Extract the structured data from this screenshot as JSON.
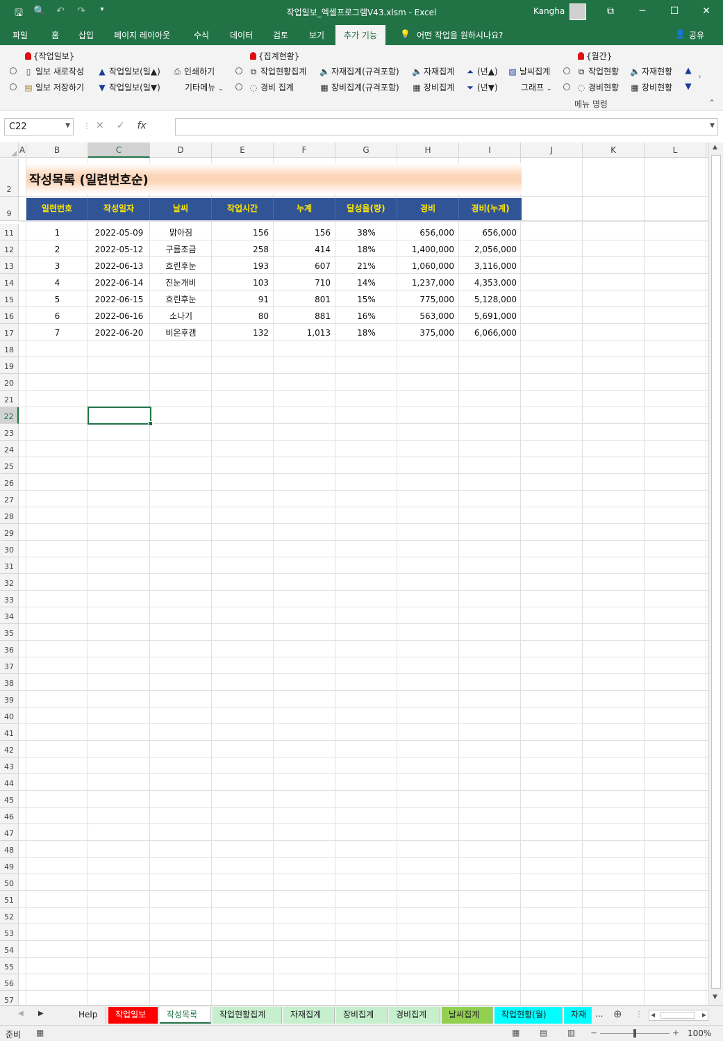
{
  "app": {
    "title": "작업일보_엑셀프로그램V43.xlsm  -  Excel",
    "user": "Kangha",
    "window_controls": [
      "restore-icon",
      "minimize-icon",
      "maximize-icon",
      "close-icon"
    ]
  },
  "qat": [
    "save-icon",
    "print-preview-icon",
    "undo-icon",
    "redo-icon",
    "customize-icon"
  ],
  "menu": {
    "items": [
      "파일",
      "홈",
      "삽입",
      "페이지 레이아웃",
      "수식",
      "데이터",
      "검토",
      "보기",
      "추가 기능"
    ],
    "active": "추가 기능",
    "tell_me": "어떤 작업을 원하시나요?",
    "share": "공유"
  },
  "ribbon": {
    "group1_header": "{작업일보}",
    "g1_new": "일보 새로작성",
    "g1_save": "일보 저장하기",
    "g1_up": "작업일보(일▲)",
    "g1_down": "작업일보(일▼)",
    "g1_print": "인쇄하기",
    "g1_other": "기타메뉴",
    "group2_header": "{집계현황}",
    "g2_work": "작업현황집계",
    "g2_cost": "경비 집계",
    "g2_mat_spec": "자재집계(규격포함)",
    "g2_eq_spec": "장비집계(규격포함)",
    "g2_mat": "자재집계",
    "g2_eq": "장비집계",
    "g2_year_up": "(년▲)",
    "g2_year_down": "(년▼)",
    "g2_weather": "날씨집계",
    "g2_graph": "그래프",
    "group3_header": "{월간}",
    "g3_work": "작업현황",
    "g3_cost": "경비현황",
    "g3_mat": "자재현황",
    "g3_eq": "장비현황",
    "footer": "메뉴 명령"
  },
  "formula": {
    "namebox": "C22",
    "value": ""
  },
  "sheet": {
    "columns": [
      "A",
      "B",
      "C",
      "D",
      "E",
      "F",
      "G",
      "H",
      "I",
      "J",
      "K",
      "L"
    ],
    "rows": [
      "2",
      "9",
      "11",
      "12",
      "13",
      "14",
      "15",
      "16",
      "17",
      "18",
      "19",
      "20",
      "21",
      "22",
      "23",
      "24",
      "25",
      "26",
      "27",
      "28",
      "29",
      "30",
      "31",
      "32",
      "33",
      "34",
      "35",
      "36",
      "37",
      "38",
      "39",
      "40",
      "41",
      "42",
      "43",
      "44",
      "45",
      "46",
      "47",
      "48",
      "49",
      "50",
      "51",
      "52",
      "53",
      "54",
      "55",
      "56",
      "57"
    ],
    "title": "작성목록 (일련번호순)",
    "headers": [
      "일련번호",
      "작성일자",
      "날씨",
      "작업시간",
      "누계",
      "달성율(량)",
      "경비",
      "경비(누계)"
    ],
    "data": [
      [
        "1",
        "2022-05-09",
        "맑아짐",
        "156",
        "156",
        "38%",
        "656,000",
        "656,000"
      ],
      [
        "2",
        "2022-05-12",
        "구름조금",
        "258",
        "414",
        "18%",
        "1,400,000",
        "2,056,000"
      ],
      [
        "3",
        "2022-06-13",
        "흐린후눈",
        "193",
        "607",
        "21%",
        "1,060,000",
        "3,116,000"
      ],
      [
        "4",
        "2022-06-14",
        "진눈개비",
        "103",
        "710",
        "14%",
        "1,237,000",
        "4,353,000"
      ],
      [
        "5",
        "2022-06-15",
        "흐린후눈",
        "91",
        "801",
        "15%",
        "775,000",
        "5,128,000"
      ],
      [
        "6",
        "2022-06-16",
        "소나기",
        "80",
        "881",
        "16%",
        "563,000",
        "5,691,000"
      ],
      [
        "7",
        "2022-06-20",
        "비온후갬",
        "132",
        "1,013",
        "18%",
        "375,000",
        "6,066,000"
      ]
    ]
  },
  "tabs": [
    "Help",
    "작업일보",
    "작성목록",
    "작업현황집계",
    "자재집계",
    "장비집계",
    "경비집계",
    "날씨집계",
    "작업현황(월)",
    "자재"
  ],
  "tab_colors": {
    "작업일보": "#ff0000",
    "작성목록": "#ffffff",
    "작업현황집계": "#c6efce",
    "자재집계": "#c6efce",
    "장비집계": "#c6efce",
    "경비집계": "#c6efce",
    "날씨집계": "#92d050",
    "작업현황(월)": "#00ffff",
    "자재": "#00ffff"
  },
  "status": {
    "ready": "준비",
    "zoom": "100%"
  }
}
